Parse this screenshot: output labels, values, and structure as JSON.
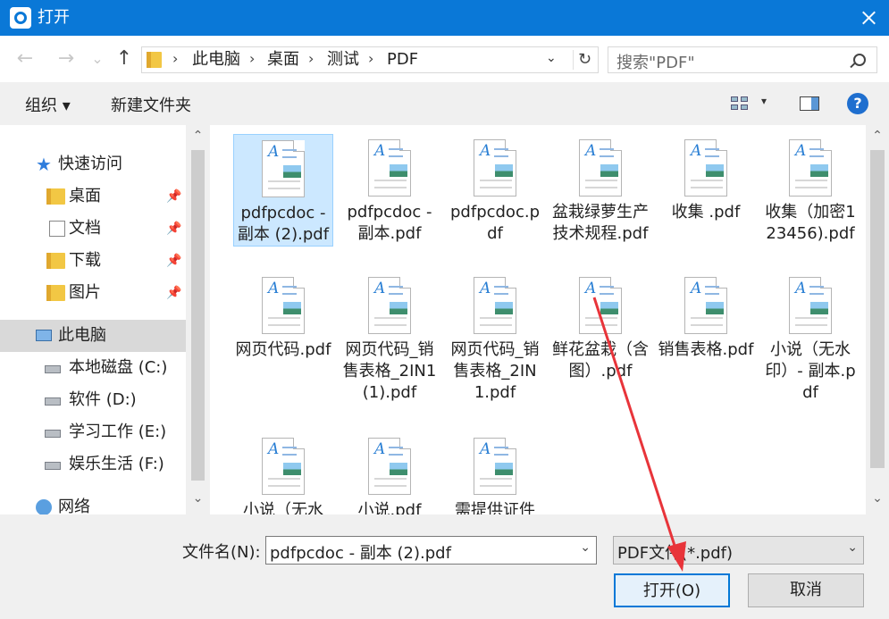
{
  "window": {
    "title": "打开",
    "close_label": "✕"
  },
  "nav": {
    "back": "←",
    "forward": "→",
    "recent": "⌄",
    "up": "↑",
    "breadcrumbs": [
      "此电脑",
      "桌面",
      "测试",
      "PDF"
    ],
    "separator": "›",
    "dropdown": "⌄",
    "refresh": "↻",
    "search_placeholder": "搜索\"PDF\""
  },
  "toolbar": {
    "organize": "组织 ▾",
    "new_folder": "新建文件夹",
    "view_dropdown": "▾",
    "help": "?"
  },
  "sidebar": {
    "items": [
      {
        "label": "快速访问",
        "icon": "star-icon",
        "pinned": false
      },
      {
        "label": "桌面",
        "icon": "desktop-folder-icon",
        "pinned": true
      },
      {
        "label": "文档",
        "icon": "documents-icon",
        "pinned": true
      },
      {
        "label": "下载",
        "icon": "downloads-icon",
        "pinned": true
      },
      {
        "label": "图片",
        "icon": "pictures-icon",
        "pinned": true
      },
      {
        "label": "此电脑",
        "icon": "computer-icon",
        "selected": true
      },
      {
        "label": "本地磁盘 (C:)",
        "icon": "drive-icon"
      },
      {
        "label": "软件 (D:)",
        "icon": "drive-icon"
      },
      {
        "label": "学习工作 (E:)",
        "icon": "drive-icon"
      },
      {
        "label": "娱乐生活 (F:)",
        "icon": "drive-icon"
      },
      {
        "label": "网络",
        "icon": "network-icon"
      }
    ],
    "pin_glyph": "📌",
    "scroll_up": "⌃",
    "scroll_down": "⌄"
  },
  "files": [
    {
      "name": "pdfpcdoc - 副本 (2).pdf",
      "selected": true
    },
    {
      "name": "pdfpcdoc - 副本.pdf"
    },
    {
      "name": "pdfpcdoc.pdf"
    },
    {
      "name": "盆栽绿萝生产技术规程.pdf"
    },
    {
      "name": "收集 .pdf"
    },
    {
      "name": "收集（加密123456).pdf"
    },
    {
      "name": "网页代码.pdf"
    },
    {
      "name": "网页代码_销售表格_2IN1(1).pdf"
    },
    {
      "name": "网页代码_销售表格_2IN1.pdf"
    },
    {
      "name": "鲜花盆栽（含图）.pdf"
    },
    {
      "name": "销售表格.pdf"
    },
    {
      "name": "小说（无水印）- 副本.pdf"
    },
    {
      "name": "小说（无水"
    },
    {
      "name": "小说.pdf"
    },
    {
      "name": "需提供证件"
    }
  ],
  "bottom": {
    "filename_label": "文件名(N):",
    "filename_value": "pdfpcdoc - 副本 (2).pdf",
    "filetype_value": "PDF文件(*.pdf)",
    "open_button": "打开(O)",
    "cancel_button": "取消",
    "dropdown": "⌄"
  },
  "colors": {
    "titlebar": "#0a78d7",
    "selection": "#cce8ff",
    "annotation_arrow": "#e8343a"
  }
}
